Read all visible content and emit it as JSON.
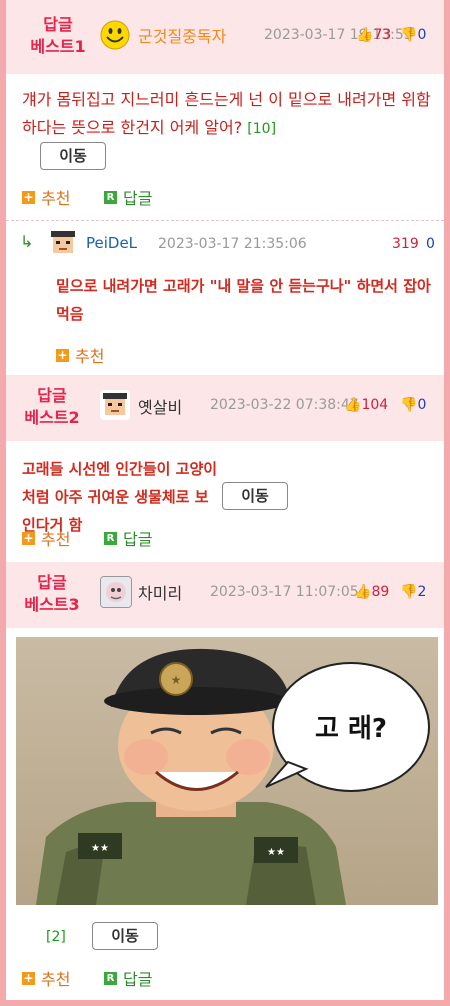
{
  "comments": [
    {
      "best_line1": "답글",
      "best_line2": "베스트1",
      "nick": "군것질중독자",
      "date": "2023-03-17 19:13:53",
      "up": "73",
      "down": "0",
      "text": "걔가 몸뒤집고 지느러미 흔드는게 넌 이 밑으로 내려가면 위함하다는 뜻으로 한건지 어케 알어?",
      "reply_count": "[10]",
      "move_label": "이동",
      "recommend_label": "추천",
      "reply_label": "답글"
    },
    {
      "nick": "PeiDeL",
      "date": "2023-03-17 21:35:06",
      "up": "319",
      "down": "0",
      "text": "밑으로 내려가면 고래가 \"내 말을 안 듣는구나\" 하면서 잡아먹음",
      "recommend_label": "추천"
    },
    {
      "best_line1": "답글",
      "best_line2": "베스트2",
      "nick": "옛살비",
      "date": "2023-03-22 07:38:47",
      "up": "104",
      "down": "0",
      "text": "고래들 시선엔 인간들이 고양이처럼 아주 귀여운 생물체로 보인다거 함",
      "move_label": "이동",
      "recommend_label": "추천",
      "reply_label": "답글"
    },
    {
      "best_line1": "답글",
      "best_line2": "베스트3",
      "nick": "차미리",
      "date": "2023-03-17 11:07:05",
      "up": "89",
      "down": "2",
      "image_caption": "고 래?",
      "reply_count": "[2]",
      "move_label": "이동",
      "recommend_label": "추천",
      "reply_label": "답글"
    }
  ],
  "colors": {
    "accent": "#e4244a",
    "header_bg": "#fde6e8",
    "frame": "#f4a9ac",
    "comment_text": "#c9201a",
    "nick_orange": "#f08a1a"
  }
}
